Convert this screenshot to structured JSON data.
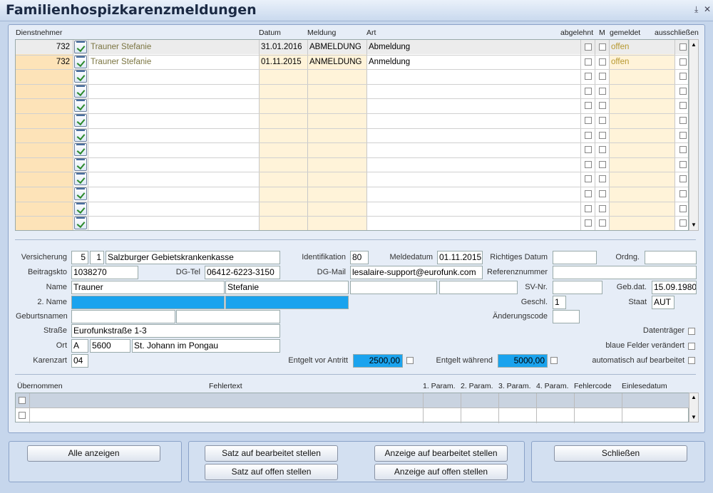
{
  "window": {
    "title": "Familienhospizkarenzmeldungen"
  },
  "grid": {
    "headers": {
      "dienstnehmer": "Dienstnehmer",
      "datum": "Datum",
      "meldung": "Meldung",
      "art": "Art",
      "abgelehnt": "abgelehnt",
      "m": "M",
      "gemeldet": "gemeldet",
      "ausschliessen": "ausschließen"
    },
    "rows": [
      {
        "nr": "732",
        "name": "Trauner Stefanie",
        "datum": "31.01.2016",
        "meldung": "ABMELDUNG",
        "art": "Abmeldung",
        "gemeldet": "offen"
      },
      {
        "nr": "732",
        "name": "Trauner Stefanie",
        "datum": "01.11.2015",
        "meldung": "ANMELDUNG",
        "art": "Anmeldung",
        "gemeldet": "offen"
      }
    ]
  },
  "form": {
    "versicherung": {
      "label": "Versicherung",
      "v1": "5",
      "v2": "1",
      "name": "Salzburger Gebietskrankenkasse"
    },
    "identifikation": {
      "label": "Identifikation",
      "value": "80"
    },
    "meldedatum": {
      "label": "Meldedatum",
      "value": "01.11.2015"
    },
    "richtiges_datum": {
      "label": "Richtiges Datum",
      "value": ""
    },
    "ordng": {
      "label": "Ordng.",
      "value": ""
    },
    "beitragskto": {
      "label": "Beitragskto",
      "value": "1038270"
    },
    "dg_tel": {
      "label": "DG-Tel",
      "value": "06412-6223-3150"
    },
    "dg_mail": {
      "label": "DG-Mail",
      "value": "lesalaire-support@eurofunk.com"
    },
    "referenznummer": {
      "label": "Referenznummer",
      "value": ""
    },
    "name": {
      "label": "Name",
      "last": "Trauner",
      "first": "Stefanie"
    },
    "sv_nr": {
      "label": "SV-Nr.",
      "value": ""
    },
    "geb_dat": {
      "label": "Geb.dat.",
      "value": "15.09.1980"
    },
    "name2": {
      "label": "2. Name"
    },
    "geschl": {
      "label": "Geschl.",
      "value": "1"
    },
    "staat": {
      "label": "Staat",
      "value": "AUT"
    },
    "geburtsnamen": {
      "label": "Geburtsnamen"
    },
    "aenderungscode": {
      "label": "Änderungscode",
      "value": ""
    },
    "strasse": {
      "label": "Straße",
      "value": "Eurofunkstraße 1-3"
    },
    "datentraeger": {
      "label": "Datenträger"
    },
    "ort": {
      "label": "Ort",
      "land": "A",
      "plz": "5600",
      "name": "St. Johann im Pongau"
    },
    "blaue_felder": {
      "label": "blaue Felder verändert"
    },
    "karenzart": {
      "label": "Karenzart",
      "value": "04"
    },
    "entgelt_vor": {
      "label": "Entgelt vor Antritt",
      "value": "2500,00"
    },
    "entgelt_waehrend": {
      "label": "Entgelt während",
      "value": "5000,00"
    },
    "auto_bearbeitet": {
      "label": "automatisch auf bearbeitet"
    }
  },
  "errors": {
    "headers": {
      "uebernommen": "Übernommen",
      "fehlertext": "Fehlertext",
      "p1": "1. Param.",
      "p2": "2. Param.",
      "p3": "3. Param.",
      "p4": "4. Param.",
      "fehlercode": "Fehlercode",
      "einlesedatum": "Einlesedatum"
    }
  },
  "buttons": {
    "alle_anzeigen": "Alle anzeigen",
    "satz_bearbeitet": "Satz auf bearbeitet stellen",
    "satz_offen": "Satz auf offen stellen",
    "anzeige_bearbeitet": "Anzeige auf bearbeitet stellen",
    "anzeige_offen": "Anzeige auf offen stellen",
    "schliessen": "Schließen"
  },
  "colors": {
    "highlight_field": "#1aa3ee",
    "grid_left": "#fde3b8",
    "grid_date": "#fff3d9"
  }
}
